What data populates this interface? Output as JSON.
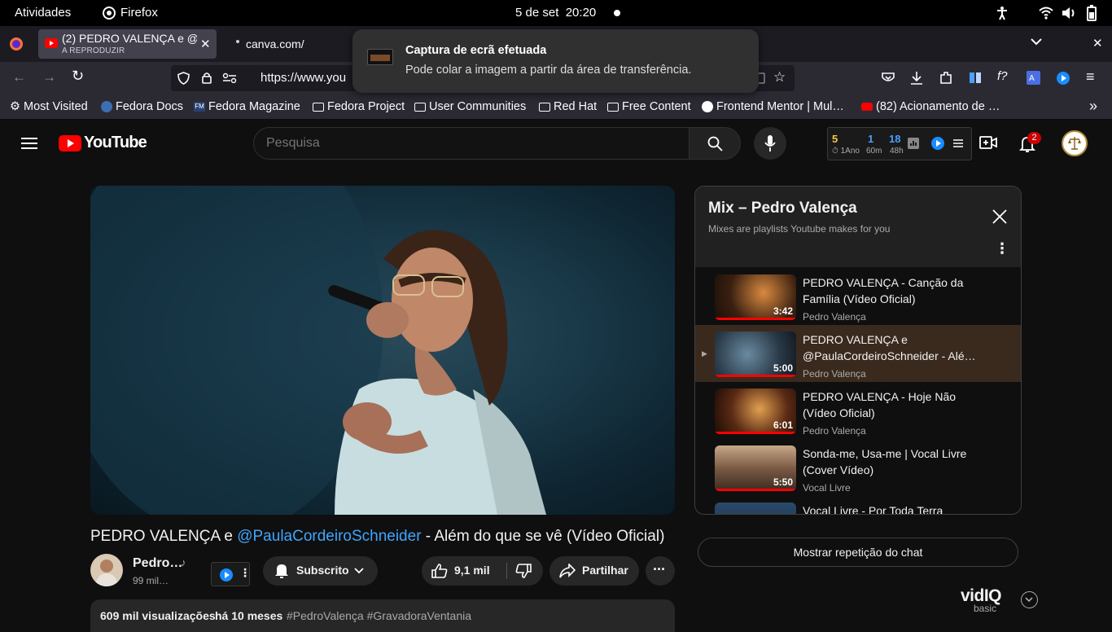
{
  "gnome": {
    "activities": "Atividades",
    "app_name": "Firefox",
    "date": "5 de set",
    "time": "20:20"
  },
  "tabs": [
    {
      "title": "(2) PEDRO VALENÇA e @P",
      "subtitle": "A REPRODUZIR"
    },
    {
      "title": "canva.com/"
    }
  ],
  "url": "https://www.you",
  "bookmarks": [
    {
      "label": "Most Visited",
      "icon": "gear-icon"
    },
    {
      "label": "Fedora Docs",
      "icon": "fedora-icon"
    },
    {
      "label": "Fedora Magazine",
      "icon": "fm-icon"
    },
    {
      "label": "Fedora Project",
      "icon": "folder-icon"
    },
    {
      "label": "User Communities",
      "icon": "folder-icon"
    },
    {
      "label": "Red Hat",
      "icon": "folder-icon"
    },
    {
      "label": "Free Content",
      "icon": "folder-icon"
    },
    {
      "label": "Frontend Mentor | Mul…",
      "icon": "frontend-mentor-icon"
    },
    {
      "label": "(82) Acionamento de …",
      "icon": "youtube-icon"
    }
  ],
  "notification": {
    "title": "Captura de ecrã efetuada",
    "body": "Pode colar a imagem a partir da área de transferência."
  },
  "youtube": {
    "logo_text": "YouTube",
    "search_placeholder": "Pesquisa",
    "notif_count": "2",
    "vidiq_stats": [
      {
        "value": "5",
        "label": "1Ano",
        "color": "#f2c94c"
      },
      {
        "value": "1",
        "label": "60m",
        "color": "#4a9fff"
      },
      {
        "value": "18",
        "label": "48h",
        "color": "#4a9fff"
      }
    ]
  },
  "video": {
    "title_prefix": "PEDRO VALENÇA e ",
    "title_mention": "@PaulaCordeiroSchneider",
    "title_suffix": " - Além do que se vê (Vídeo Oficial)",
    "channel_name": "Pedro…",
    "subscribers": "99 mil…",
    "subscribe_label": "Subscrito",
    "likes": "9,1 mil",
    "share_label": "Partilhar",
    "views": "609 mil visualizações",
    "age": "há 10 meses",
    "tags": "#PedroValença #GravadoraVentania"
  },
  "mix": {
    "title": "Mix – Pedro Valença",
    "subtitle": "Mixes are playlists Youtube makes for you",
    "items": [
      {
        "title": "PEDRO VALENÇA - Canção da Família (Vídeo Oficial)",
        "channel": "Pedro Valença",
        "duration": "3:42",
        "active": false
      },
      {
        "title": "PEDRO VALENÇA e @PaulaCordeiroSchneider - Alé…",
        "channel": "Pedro Valença",
        "duration": "5:00",
        "active": true
      },
      {
        "title": "PEDRO VALENÇA - Hoje Não (Vídeo Oficial)",
        "channel": "Pedro Valença",
        "duration": "6:01",
        "active": false
      },
      {
        "title": "Sonda-me, Usa-me | Vocal Livre (Cover Vídeo)",
        "channel": "Vocal Livre",
        "duration": "5:50",
        "active": false
      },
      {
        "title": "Vocal Livre - Por Toda Terra",
        "channel": "",
        "duration": "",
        "active": false
      }
    ]
  },
  "chat_replay_label": "Mostrar repetição do chat",
  "vidiq_badge": {
    "logo": "vidIQ",
    "tier": "basic"
  }
}
